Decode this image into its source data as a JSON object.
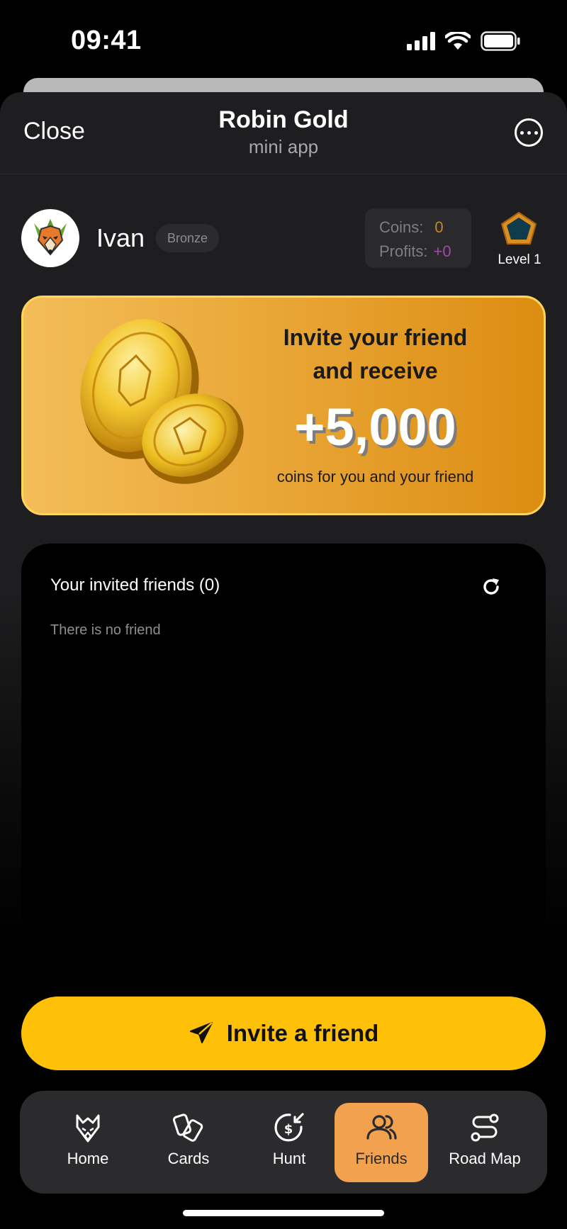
{
  "status_bar": {
    "time": "09:41"
  },
  "header": {
    "close_label": "Close",
    "title": "Robin Gold",
    "subtitle": "mini app"
  },
  "profile": {
    "name": "Ivan",
    "rank": "Bronze",
    "coins_label": "Coins:",
    "coins_value": "0",
    "profits_label": "Profits:",
    "profits_value": "+0",
    "level_label": "Level 1"
  },
  "promo": {
    "line1": "Invite your friend",
    "line2": "and receive",
    "amount": "+5,000",
    "caption": "coins for you and your friend"
  },
  "friends": {
    "title": "Your invited friends (0)",
    "empty_text": "There is no friend"
  },
  "invite_button": {
    "label": "Invite a friend"
  },
  "nav": {
    "items": [
      {
        "label": "Home",
        "icon": "fox-icon"
      },
      {
        "label": "Cards",
        "icon": "cards-icon"
      },
      {
        "label": "Hunt",
        "icon": "hunt-icon"
      },
      {
        "label": "Friends",
        "icon": "friends-icon",
        "active": true
      },
      {
        "label": "Road Map",
        "icon": "road-map-icon"
      }
    ]
  },
  "colors": {
    "accent_yellow": "#ffc107",
    "nav_active": "#f2a14e",
    "coins_value": "#c5862b",
    "profits_value": "#a248a9"
  }
}
